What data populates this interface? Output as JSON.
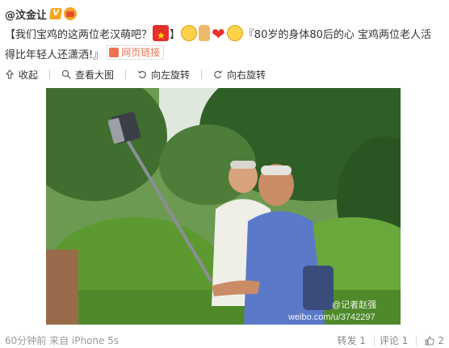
{
  "header": {
    "username": "@汶金让",
    "vip_letter": "V"
  },
  "content": {
    "part1": "【我们宝鸡的这两位老汉萌吧？",
    "part2": "】",
    "part3": "『80岁的身体80后的心 宝鸡两位老人活得比年轻人还潇洒!』",
    "link_label": "网页链接"
  },
  "toolbar": {
    "collapse": "收起",
    "view_large": "查看大图",
    "rotate_left": "向左旋转",
    "rotate_right": "向右旋转"
  },
  "photo": {
    "watermark": "@记者赵强",
    "watermark_url": "weibo.com/u/3742297"
  },
  "footer": {
    "meta": "60分钟前 来自 iPhone 5s",
    "repost": "转发 1",
    "comment": "评论 1",
    "like_count": "2"
  }
}
